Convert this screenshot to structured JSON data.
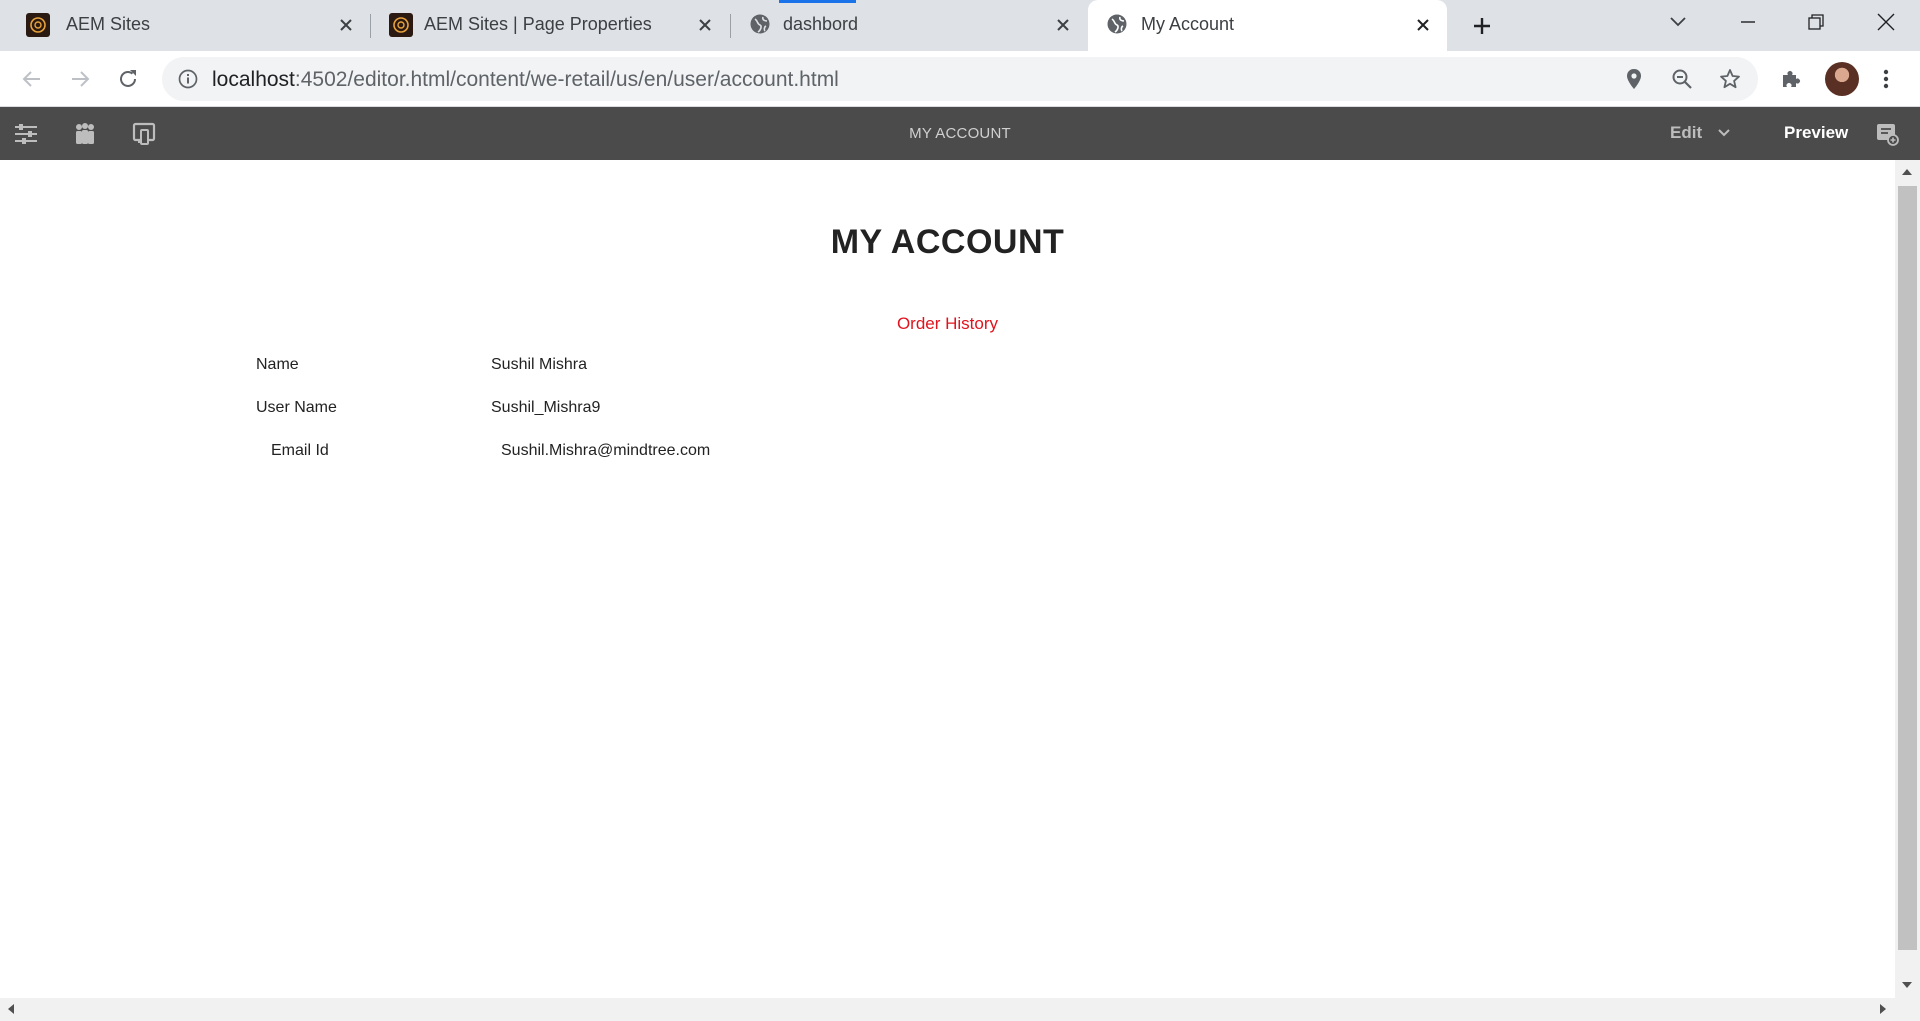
{
  "browser": {
    "tabs": [
      {
        "title": "AEM Sites",
        "favicon": "aem-icon",
        "active": false
      },
      {
        "title": "AEM Sites | Page Properties",
        "favicon": "aem-icon",
        "active": false
      },
      {
        "title": "dashbord",
        "favicon": "globe-icon",
        "active": false,
        "loading": true
      },
      {
        "title": "My Account",
        "favicon": "globe-icon",
        "active": true
      }
    ],
    "url": {
      "host": "localhost",
      "path": ":4502/editor.html/content/we-retail/us/en/user/account.html"
    },
    "accent_color": "#1a73e8"
  },
  "editor": {
    "page_title": "MY ACCOUNT",
    "mode_label": "Edit",
    "preview_label": "Preview",
    "bar_color": "#4b4b4b"
  },
  "page": {
    "heading": "MY ACCOUNT",
    "order_history_link": "Order History",
    "link_color": "#e0141e",
    "fields": [
      {
        "label": "Name",
        "value": "Sushil Mishra"
      },
      {
        "label": "User Name",
        "value": "Sushil_Mishra9"
      },
      {
        "label": "Email Id",
        "value": "Sushil.Mishra@mindtree.com"
      }
    ]
  }
}
